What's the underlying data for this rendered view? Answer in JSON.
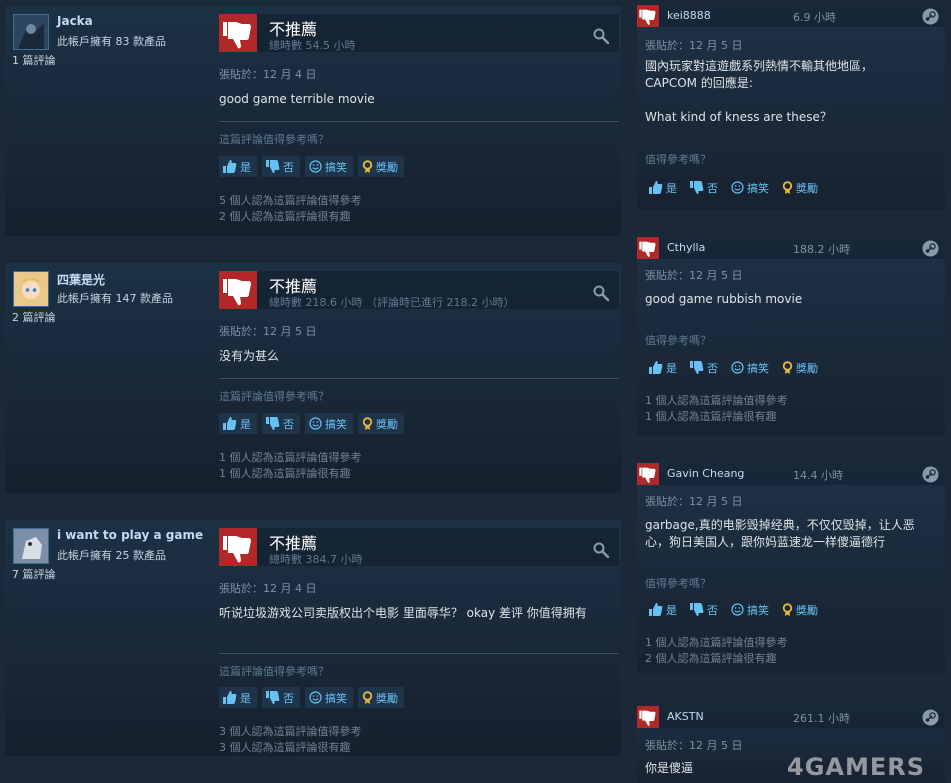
{
  "colors": {
    "bg": "#1b2838",
    "not_recommended": "#b22727",
    "link": "#67c1f5"
  },
  "reviews": [
    {
      "user": "Jacka",
      "owned": "此帳戶擁有 83 款產品",
      "review_count": "1 篇評論",
      "verdict": "不推薦",
      "hours": "總時數 54.5 小時",
      "posted": "張貼於：12 月 4 日",
      "body": "good game terrible movie",
      "question": "這篇評論值得參考嗎？",
      "helpful_stat": "5 個人認為這篇評論值得參考",
      "funny_stat": "2 個人認為這篇評論很有趣"
    },
    {
      "user": "四葉是光",
      "owned": "此帳戶擁有 147 款產品",
      "review_count": "2 篇評論",
      "verdict": "不推薦",
      "hours": "總時數 218.6 小時 （評論時已進行 218.2 小時）",
      "posted": "張貼於：12 月 5 日",
      "body": "没有为甚么",
      "question": "這篇評論值得參考嗎？",
      "helpful_stat": "1 個人認為這篇評論值得參考",
      "funny_stat": "1 個人認為這篇評論很有趣"
    },
    {
      "user": "i want to play a game",
      "owned": "此帳戶擁有 25 款產品",
      "review_count": "7 篇評論",
      "verdict": "不推薦",
      "hours": "總時數 384.7 小時",
      "posted": "張貼於：12 月 4 日",
      "body": "听说垃圾游戏公司卖版权出个电影 里面辱华？ okay 差评 你值得拥有",
      "question": "這篇評論值得參考嗎？",
      "helpful_stat": "3 個人認為這篇評論值得參考",
      "funny_stat": "3 個人認為這篇評論很有趣"
    }
  ],
  "side_reviews": [
    {
      "user": "kei8888",
      "hours": "6.9 小時",
      "posted": "張貼於：12 月 5 日",
      "body": "國內玩家對這遊戲系列熱情不輸其他地區，\nCAPCOM 的回應是:\n\nWhat kind of kness are these？",
      "question": "值得參考嗎？",
      "helpful_stat": "",
      "funny_stat": ""
    },
    {
      "user": "Cthylla",
      "hours": "188.2 小時",
      "posted": "張貼於：12 月 5 日",
      "body": "good game rubbish movie",
      "question": "值得參考嗎？",
      "helpful_stat": "1 個人認為這篇評論值得參考",
      "funny_stat": "1 個人認為這篇評論很有趣"
    },
    {
      "user": "Gavin Cheang",
      "hours": "14.4 小時",
      "posted": "張貼於：12 月 5 日",
      "body": "garbage,真的电影毁掉经典，不仅仅毁掉，让人恶心，狗日美国人，跟你妈蓝速龙一样傻逼德行",
      "question": "值得參考嗎？",
      "helpful_stat": "1 個人認為這篇評論值得參考",
      "funny_stat": "2 個人認為這篇評論很有趣"
    },
    {
      "user": "AKSTN",
      "hours": "261.1 小時",
      "posted": "張貼於：12 月 5 日",
      "body": "你是傻逼",
      "question": "",
      "helpful_stat": "",
      "funny_stat": ""
    }
  ],
  "buttons": {
    "yes": "是",
    "no": "否",
    "funny": "搞笑",
    "award": "獎勵"
  },
  "icons": {
    "thumb_down": "thumbs-down-icon",
    "thumb_up": "thumbs-up-icon",
    "funny": "smiley-icon",
    "award": "award-icon",
    "search": "magnifier-icon",
    "steam": "steam-icon"
  },
  "watermark": "4GAMERS"
}
